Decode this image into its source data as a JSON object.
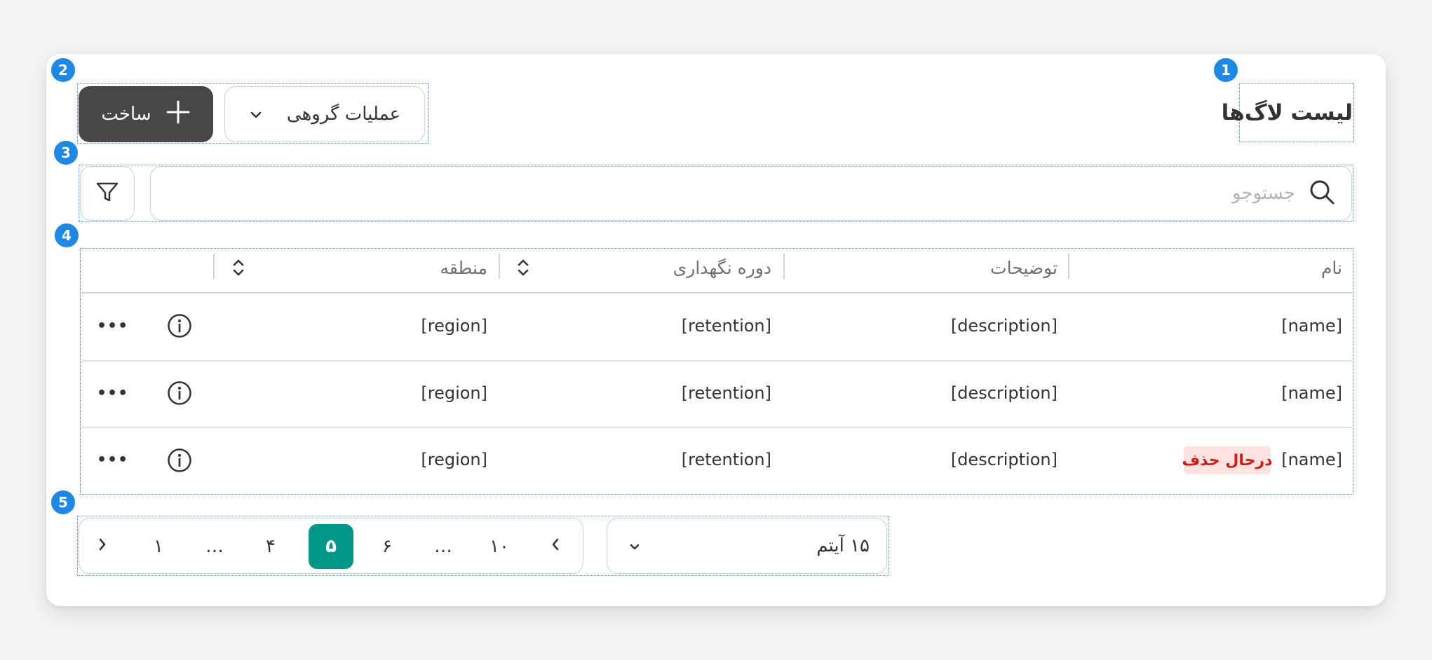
{
  "header": {
    "title": "لیست لاگ‌ها",
    "create_label": "ساخت",
    "bulk_label": "عملیات گروهی"
  },
  "search": {
    "placeholder": "جستوجو"
  },
  "table": {
    "columns": [
      "نام",
      "توضیحات",
      "دوره نگهداری",
      "منطقه"
    ],
    "rows": [
      {
        "name": "[name]",
        "description": "[description]",
        "retention": "[retention]",
        "region": "[region]",
        "badge": ""
      },
      {
        "name": "[name]",
        "description": "[description]",
        "retention": "[retention]",
        "region": "[region]",
        "badge": ""
      },
      {
        "name": "[name]",
        "description": "[description]",
        "retention": "[retention]",
        "region": "[region]",
        "badge": "درحال حذف"
      }
    ],
    "more_glyph": "•••"
  },
  "pagination": {
    "pages": [
      "۱",
      "…",
      "۴",
      "۵",
      "۶",
      "…",
      "۱۰"
    ],
    "current": "۵",
    "per_page": "۱۵ آیتم"
  },
  "annotations": [
    "1",
    "2",
    "3",
    "4",
    "5"
  ],
  "colors": {
    "primary_dark": "#474747",
    "accent_teal": "#009688",
    "marker_blue": "#1e88e5",
    "danger": "#d11a1a",
    "danger_bg": "#fde2e2"
  }
}
